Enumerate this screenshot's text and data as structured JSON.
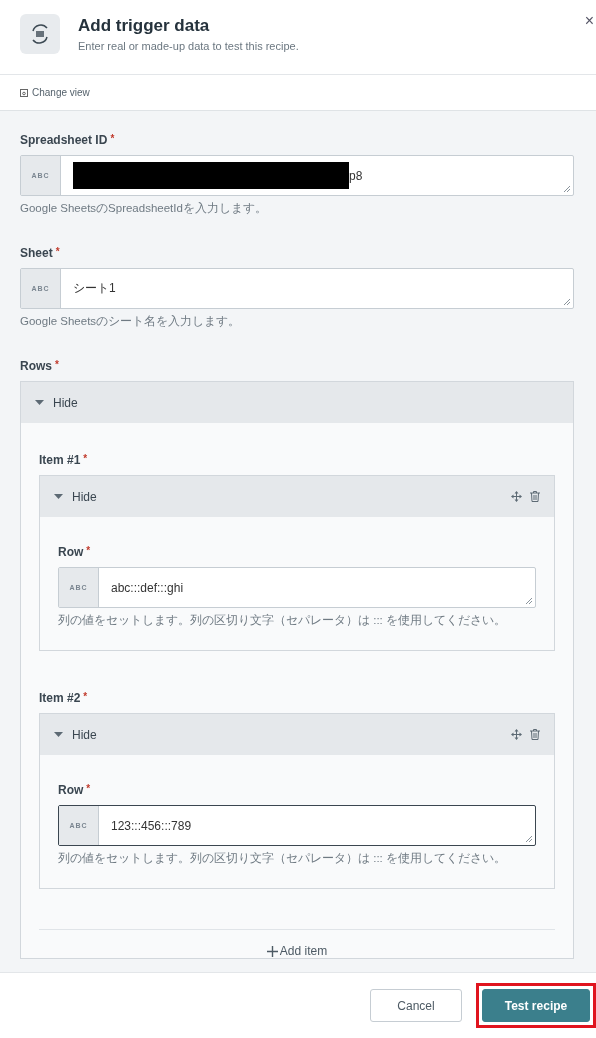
{
  "header": {
    "title": "Add trigger data",
    "subtitle": "Enter real or made-up data to test this recipe.",
    "close": "×"
  },
  "toolbar": {
    "change_view": "Change view"
  },
  "fields": [
    {
      "label": "Spreadsheet ID",
      "required_mark": "*",
      "type_tag": "ABC",
      "value": "p8",
      "redacted": true,
      "hint": "Google SheetsのSpreadsheetIdを入力します。"
    },
    {
      "label": "Sheet",
      "required_mark": "*",
      "type_tag": "ABC",
      "value": "シート1",
      "hint": "Google Sheetsのシート名を入力します。"
    }
  ],
  "rows": {
    "label": "Rows",
    "required_mark": "*",
    "toggle": "Hide",
    "items": [
      {
        "label": "Item #1",
        "required_mark": "*",
        "toggle": "Hide",
        "field": {
          "label": "Row",
          "required_mark": "*",
          "type_tag": "ABC",
          "value": "abc:::def:::ghi",
          "focused": false,
          "hint": "列の値をセットします。列の区切り文字（セパレータ）は ::: を使用してください。"
        }
      },
      {
        "label": "Item #2",
        "required_mark": "*",
        "toggle": "Hide",
        "field": {
          "label": "Row",
          "required_mark": "*",
          "type_tag": "ABC",
          "value": "123:::456:::789",
          "focused": true,
          "hint": "列の値をセットします。列の区切り文字（セパレータ）は ::: を使用してください。"
        }
      }
    ],
    "add_item": "Add item"
  },
  "footer": {
    "buttons": [
      {
        "label": "Cancel",
        "kind": "secondary",
        "highlighted": false
      },
      {
        "label": "Test recipe",
        "kind": "primary",
        "highlighted": true
      }
    ]
  }
}
